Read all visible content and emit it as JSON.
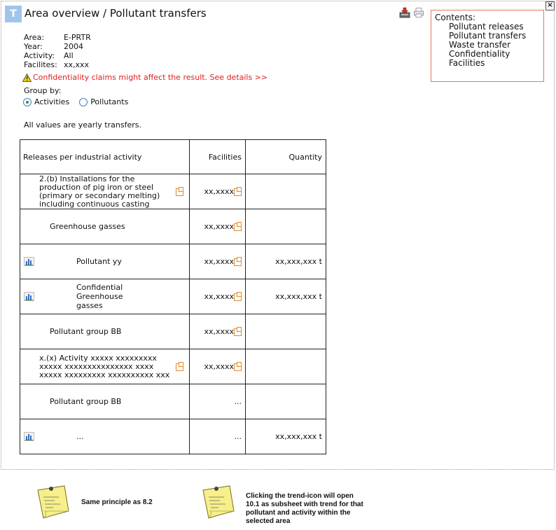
{
  "header": {
    "logo_letter": "T",
    "title": "Area overview / Pollutant transfers"
  },
  "toolbar": {
    "download_icon": "download-icon",
    "print_icon": "print-icon",
    "close_label": "×"
  },
  "contents": {
    "heading": "Contents:",
    "items": [
      "Pollutant releases",
      "Pollutant transfers",
      "Waste transfer",
      "Confidentiality",
      "Facilities"
    ]
  },
  "meta": [
    {
      "key": "Area:",
      "value": "E-PRTR"
    },
    {
      "key": "Year:",
      "value": "2004"
    },
    {
      "key": "Activity:",
      "value": "All"
    },
    {
      "key": "Facilites:",
      "value": "xx,xxx"
    }
  ],
  "warning": "Confidentiality claims might affect the result. See details >>",
  "group_by": {
    "label": "Group by:",
    "options": [
      "Activities",
      "Pollutants"
    ],
    "selected": "Activities"
  },
  "values_note": "All values are yearly transfers.",
  "table": {
    "headers": [
      "Releases per industrial activity",
      "Facilities",
      "Quantity"
    ],
    "rows": [
      {
        "label": "2.(b) Installations for the production of pig iron or steel (primary or secondary melting) including continuous casting",
        "facilities": "xx,xxxx",
        "quantity": ""
      },
      {
        "label": "Greenhouse gasses",
        "facilities": "xx,xxxx",
        "quantity": ""
      },
      {
        "label": "Pollutant yy",
        "facilities": "xx,xxxx",
        "quantity": "xx,xxx,xxx t"
      },
      {
        "label": "Confidential Greenhouse gasses",
        "facilities": "xx,xxxx",
        "quantity": "xx,xxx,xxx t"
      },
      {
        "label": "Pollutant group BB",
        "facilities": "xx,xxxx",
        "quantity": ""
      },
      {
        "label": "x.(x) Activity xxxxx xxxxxxxxx xxxxx xxxxxxxxxxxxxxx xxxx xxxxx xxxxxxxxx xxxxxxxxxx xxx",
        "facilities": "xx,xxxx",
        "quantity": ""
      },
      {
        "label": "Pollutant group BB",
        "facilities": "...",
        "quantity": ""
      },
      {
        "label": "...",
        "facilities": "...",
        "quantity": "xx,xxx,xxx t"
      }
    ]
  },
  "notes": [
    {
      "text": "Same principle as 8.2"
    },
    {
      "text": "Clicking the trend-icon will open 10.1 as subsheet with trend for that pollutant and activity within the selected area"
    }
  ],
  "colors": {
    "accent": "#9fc6ea",
    "warning": "#e0201e",
    "contents_border": "#e8785c",
    "link_icon": "#e08a2c"
  }
}
